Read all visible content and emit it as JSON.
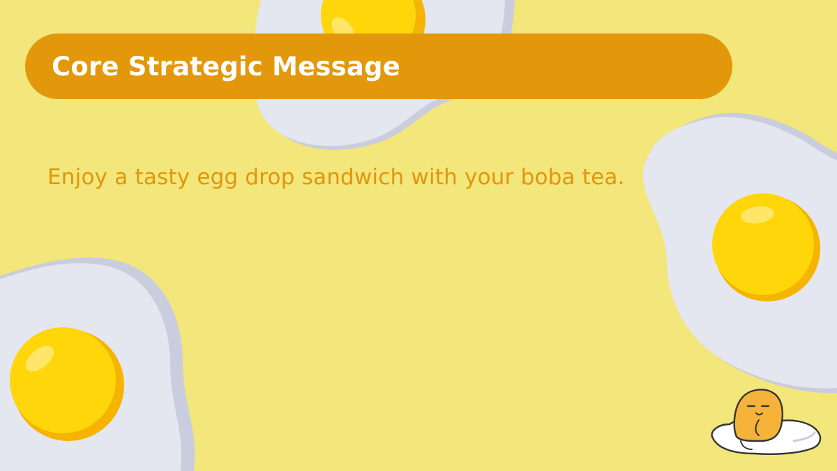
{
  "slide": {
    "title": "Core Strategic Message",
    "message": "Enjoy a tasty egg drop sandwich with your boba tea."
  },
  "colors": {
    "background": "#F3E67A",
    "title_bar": "#E3980B",
    "title_text": "#FFFFFF",
    "message_text": "#E0960E",
    "egg_white": "#E4E6F0",
    "egg_white_shadow": "#C9CDDD",
    "yolk": "#FFD60A",
    "yolk_shadow": "#F5B400"
  },
  "decorations": {
    "egg_icon": "fried-egg-icon",
    "mascot_icon": "lazy-egg-mascot-icon"
  }
}
